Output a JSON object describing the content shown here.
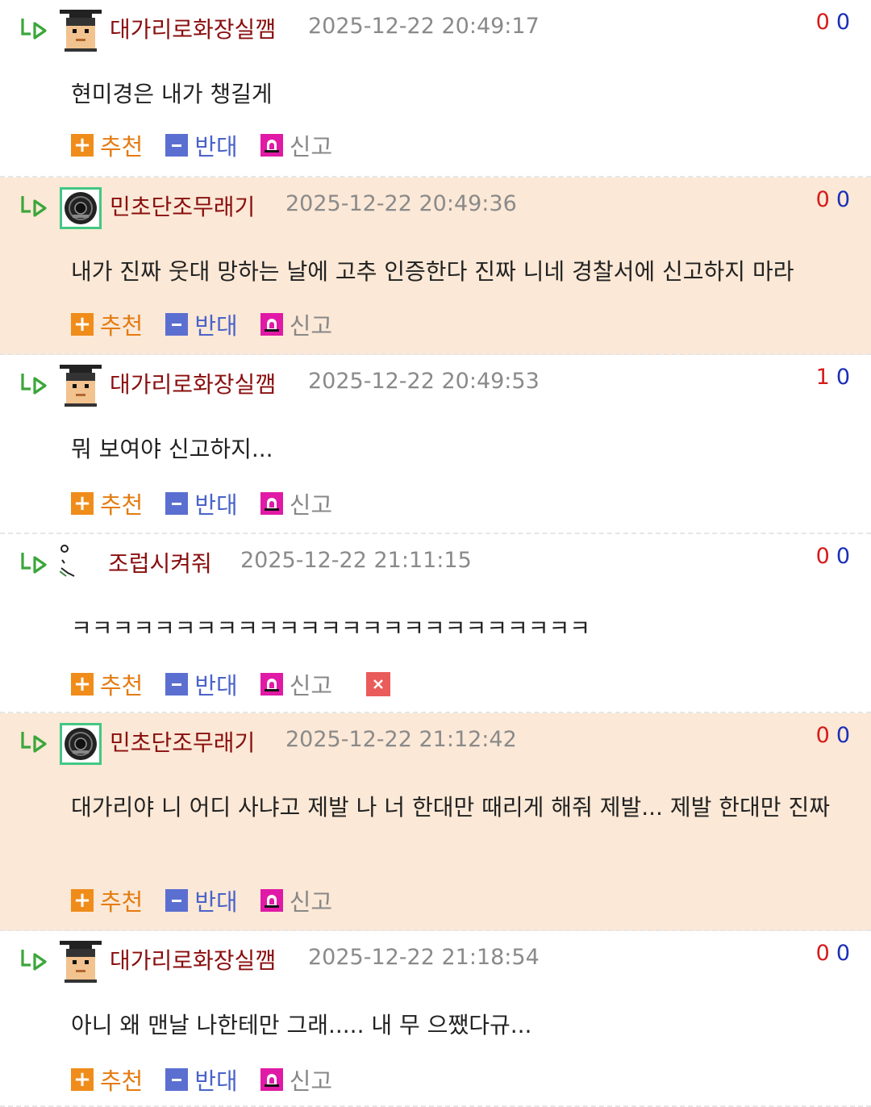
{
  "labels": {
    "recommend": "추천",
    "oppose": "반대",
    "report": "신고"
  },
  "icons": {
    "reply": "reply-arrow-icon",
    "recommend": "plus-icon",
    "oppose": "minus-icon",
    "report": "siren-icon",
    "delete": "close-icon"
  },
  "colors": {
    "nickname": "#8a0e0e",
    "highlight_bg": "#fbe8d6",
    "vote_up": "#d61a1a",
    "vote_down": "#1a2fb8",
    "recommend": "#f08c1a",
    "oppose": "#5b6fd1",
    "report": "#e01aa6",
    "delete": "#ea5b5b"
  },
  "comments": [
    {
      "nick": "대가리로화장실깸",
      "date": "2025-12-22 20:49:17",
      "up": "0",
      "down": "0",
      "text": "현미경은 내가 챙길게",
      "highlighted": false,
      "avatar": "pixel-face-avatar",
      "deletable": false
    },
    {
      "nick": "민초단조무래기",
      "date": "2025-12-22 20:49:36",
      "up": "0",
      "down": "0",
      "text": "내가 진짜 웃대 망하는 날에 고추 인증한다 진짜 니네 경찰서에 신고하지 마라",
      "highlighted": true,
      "avatar": "dial-avatar",
      "deletable": false
    },
    {
      "nick": "대가리로화장실깸",
      "date": "2025-12-22 20:49:53",
      "up": "1",
      "down": "0",
      "text": "뭐 보여야 신고하지...",
      "highlighted": false,
      "avatar": "pixel-face-avatar",
      "deletable": false
    },
    {
      "nick": "조럽시켜줘",
      "date": "2025-12-22 21:11:15",
      "up": "0",
      "down": "0",
      "text": "ㅋㅋㅋㅋㅋㅋㅋㅋㅋㅋㅋㅋㅋㅋㅋㅋㅋㅋㅋㅋㅋㅋㅋㅋㅋ",
      "highlighted": false,
      "avatar": "small-sketch-avatar",
      "deletable": true
    },
    {
      "nick": "민초단조무래기",
      "date": "2025-12-22 21:12:42",
      "up": "0",
      "down": "0",
      "text": "대가리야 니 어디 사냐고 제발 나 너 한대만 때리게 해줘 제발... 제발 한대만 진짜",
      "highlighted": true,
      "avatar": "dial-avatar",
      "deletable": false
    },
    {
      "nick": "대가리로화장실깸",
      "date": "2025-12-22 21:18:54",
      "up": "0",
      "down": "0",
      "text": "아니 왜 맨날 나한테만 그래..... 내 무 으쨌다규...",
      "highlighted": false,
      "avatar": "pixel-face-avatar",
      "deletable": false
    }
  ]
}
